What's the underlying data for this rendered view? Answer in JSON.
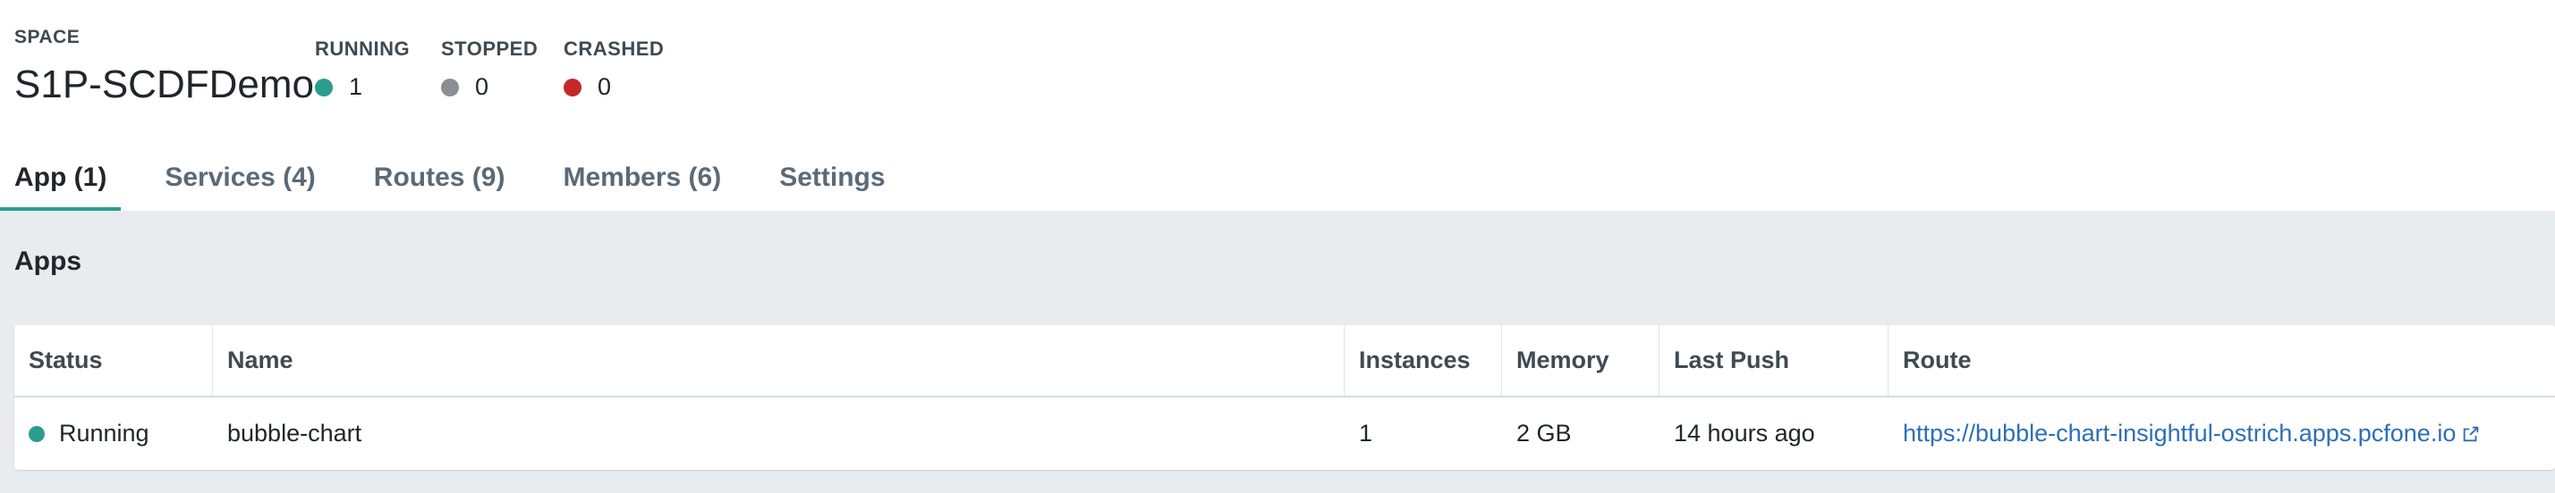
{
  "space": {
    "label": "SPACE",
    "name": "S1P-SCDFDemo"
  },
  "stats": {
    "running": {
      "label": "RUNNING",
      "value": "1",
      "color": "#2a9d8f"
    },
    "stopped": {
      "label": "STOPPED",
      "value": "0",
      "color": "#8a8f94"
    },
    "crashed": {
      "label": "CRASHED",
      "value": "0",
      "color": "#c62828"
    }
  },
  "tabs": [
    {
      "label": "App (1)",
      "active": true
    },
    {
      "label": "Services (4)",
      "active": false
    },
    {
      "label": "Routes (9)",
      "active": false
    },
    {
      "label": "Members (6)",
      "active": false
    },
    {
      "label": "Settings",
      "active": false
    }
  ],
  "apps_section": {
    "title": "Apps",
    "columns": [
      "Status",
      "Name",
      "Instances",
      "Memory",
      "Last Push",
      "Route"
    ],
    "rows": [
      {
        "status": "Running",
        "status_icon": "status-dot-green",
        "name": "bubble-chart",
        "instances": "1",
        "memory": "2 GB",
        "last_push": "14 hours ago",
        "route": "https://bubble-chart-insightful-ostrich.apps.pcfone.io",
        "route_icon": "external-link-icon"
      }
    ]
  }
}
